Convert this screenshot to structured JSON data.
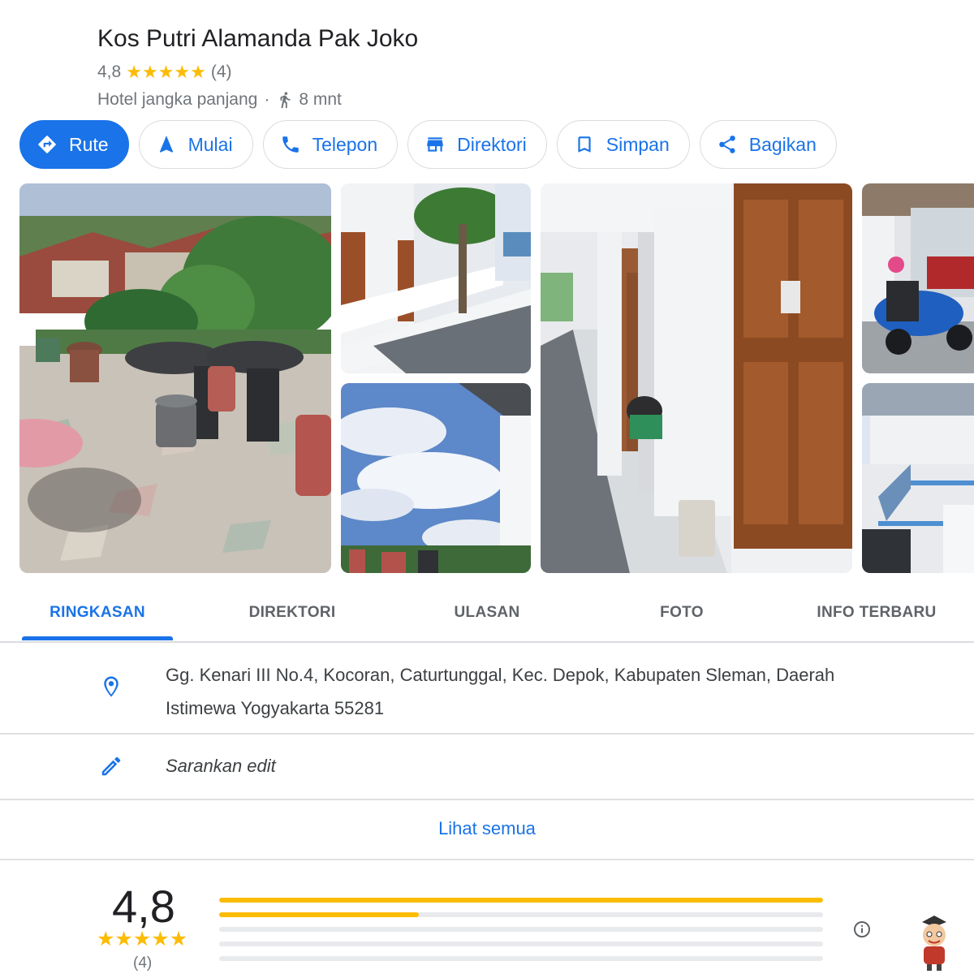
{
  "place": {
    "name": "Kos Putri Alamanda Pak Joko",
    "rating": "4,8",
    "review_count": "(4)",
    "stars_value": 4.8,
    "type": "Hotel jangka panjang",
    "separator": "·",
    "walk_time": "8 mnt"
  },
  "actions": [
    {
      "label": "Rute",
      "icon": "directions-icon"
    },
    {
      "label": "Mulai",
      "icon": "navigation-arrow-icon"
    },
    {
      "label": "Telepon",
      "icon": "phone-icon"
    },
    {
      "label": "Direktori",
      "icon": "storefront-icon"
    },
    {
      "label": "Simpan",
      "icon": "bookmark-icon"
    },
    {
      "label": "Bagikan",
      "icon": "share-icon"
    }
  ],
  "photos": [
    {
      "name": "photo-rooftop-terrace"
    },
    {
      "name": "photo-upper-corridor"
    },
    {
      "name": "photo-sky-clouds"
    },
    {
      "name": "photo-hallway-doors"
    },
    {
      "name": "photo-parked-scooters"
    },
    {
      "name": "photo-stairs"
    }
  ],
  "tabs": [
    "RINGKASAN",
    "DIREKTORI",
    "ULASAN",
    "FOTO",
    "INFO TERBARU"
  ],
  "active_tab": "RINGKASAN",
  "details": {
    "address_line1": "Gg. Kenari III No.4, Kocoran, Caturtunggal, Kec. Depok, Kabupaten Sleman, Daerah",
    "address_line2": "Istimewa Yogyakarta 55281",
    "suggest_edit": "Sarankan edit",
    "see_all": "Lihat semua"
  },
  "reviews": {
    "average": "4,8",
    "count": "(4)",
    "distribution": [
      {
        "stars": 5,
        "fraction": 1.0
      },
      {
        "stars": 4,
        "fraction": 0.33
      },
      {
        "stars": 3,
        "fraction": 0
      },
      {
        "stars": 2,
        "fraction": 0
      },
      {
        "stars": 1,
        "fraction": 0
      }
    ]
  },
  "colors": {
    "accent": "#1a73e8",
    "star": "#fbbc04",
    "text_secondary": "#70757a"
  }
}
